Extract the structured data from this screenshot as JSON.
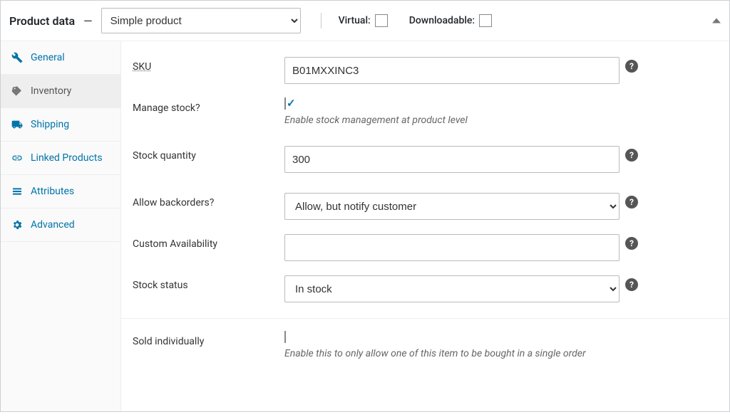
{
  "header": {
    "title": "Product data",
    "dash": "—",
    "product_type_selected": "Simple product",
    "product_type_options": [
      "Simple product"
    ],
    "virtual_label": "Virtual:",
    "virtual_checked": false,
    "downloadable_label": "Downloadable:",
    "downloadable_checked": false
  },
  "tabs": [
    {
      "id": "general",
      "label": "General",
      "icon": "wrench-icon"
    },
    {
      "id": "inventory",
      "label": "Inventory",
      "icon": "tag-icon",
      "active": true
    },
    {
      "id": "shipping",
      "label": "Shipping",
      "icon": "truck-icon"
    },
    {
      "id": "linked",
      "label": "Linked Products",
      "icon": "link-icon"
    },
    {
      "id": "attributes",
      "label": "Attributes",
      "icon": "list-icon"
    },
    {
      "id": "advanced",
      "label": "Advanced",
      "icon": "gear-icon"
    }
  ],
  "inventory": {
    "sku_label": "SKU",
    "sku_value": "B01MXXINC3",
    "manage_stock_label": "Manage stock?",
    "manage_stock_checked": true,
    "manage_stock_hint": "Enable stock management at product level",
    "stock_qty_label": "Stock quantity",
    "stock_qty_value": "300",
    "backorders_label": "Allow backorders?",
    "backorders_selected": "Allow, but notify customer",
    "backorders_options": [
      "Allow, but notify customer"
    ],
    "custom_avail_label": "Custom Availability",
    "custom_avail_value": "",
    "stock_status_label": "Stock status",
    "stock_status_selected": "In stock",
    "stock_status_options": [
      "In stock"
    ],
    "sold_individually_label": "Sold individually",
    "sold_individually_checked": false,
    "sold_individually_hint": "Enable this to only allow one of this item to be bought in a single order"
  },
  "icons": {
    "help": "?"
  }
}
